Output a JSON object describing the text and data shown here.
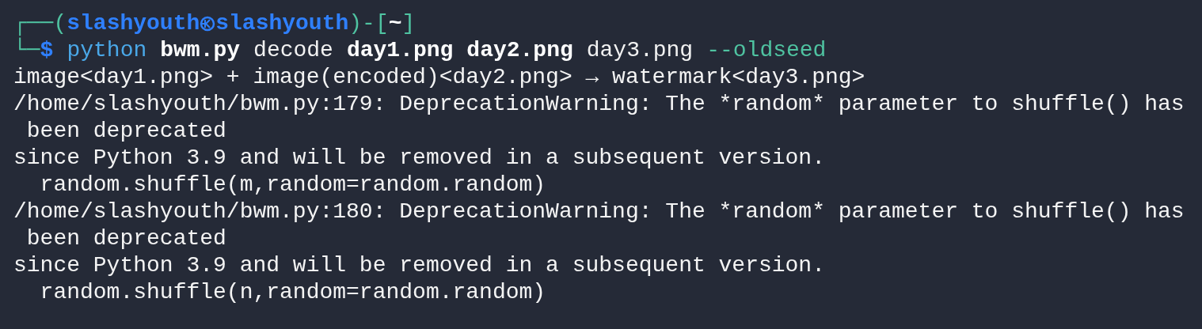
{
  "prompt": {
    "open": "┌──(",
    "user": "slashyouth",
    "host": "slashyouth",
    "middle": ")-[",
    "dir": "~",
    "close": "]",
    "corner": "└─",
    "symbol": "$"
  },
  "command": [
    {
      "text": "python",
      "kind": "program"
    },
    {
      "text": "bwm.py",
      "kind": "file"
    },
    {
      "text": "decode",
      "kind": "arg"
    },
    {
      "text": "day1.png",
      "kind": "file"
    },
    {
      "text": "day2.png",
      "kind": "file"
    },
    {
      "text": "day3.png",
      "kind": "arg"
    },
    {
      "text": "--oldseed",
      "kind": "option"
    }
  ],
  "output": [
    "image<day1.png> + image(encoded)<day2.png> → watermark<day3.png>",
    "/home/slashyouth/bwm.py:179: DeprecationWarning: The *random* parameter to shuffle() has",
    " been deprecated",
    "since Python 3.9 and will be removed in a subsequent version.",
    "  random.shuffle(m,random=random.random)",
    "/home/slashyouth/bwm.py:180: DeprecationWarning: The *random* parameter to shuffle() has",
    " been deprecated",
    "since Python 3.9 and will be removed in a subsequent version.",
    "  random.shuffle(n,random=random.random)"
  ]
}
